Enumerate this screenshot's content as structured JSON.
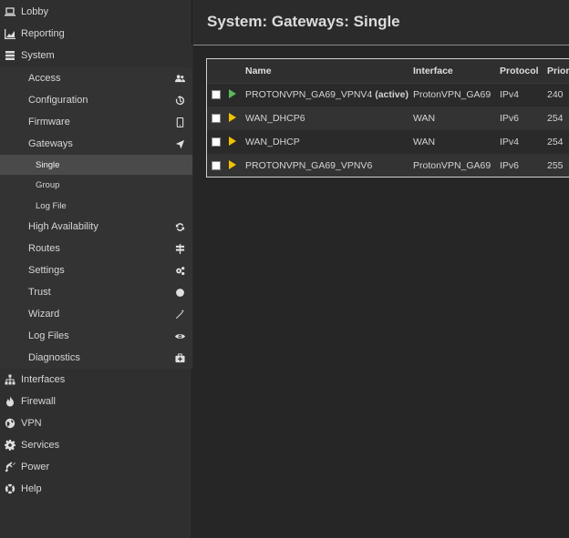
{
  "sidebar": {
    "top_items": [
      {
        "label": "Lobby",
        "icon": "laptop-icon"
      },
      {
        "label": "Reporting",
        "icon": "area-chart-icon"
      },
      {
        "label": "System",
        "icon": "server-icon"
      }
    ],
    "system_items": [
      {
        "label": "Access",
        "icon": "users-icon"
      },
      {
        "label": "Configuration",
        "icon": "history-icon"
      },
      {
        "label": "Firmware",
        "icon": "tablet-icon"
      },
      {
        "label": "Gateways",
        "icon": "location-arrow-icon"
      }
    ],
    "gateway_items": [
      {
        "label": "Single",
        "active": true
      },
      {
        "label": "Group",
        "active": false
      },
      {
        "label": "Log File",
        "active": false
      }
    ],
    "system_items_after": [
      {
        "label": "High Availability",
        "icon": "refresh-icon"
      },
      {
        "label": "Routes",
        "icon": "map-signs-icon"
      },
      {
        "label": "Settings",
        "icon": "cogs-icon"
      },
      {
        "label": "Trust",
        "icon": "certificate-icon"
      },
      {
        "label": "Wizard",
        "icon": "magic-icon"
      },
      {
        "label": "Log Files",
        "icon": "eye-icon"
      },
      {
        "label": "Diagnostics",
        "icon": "medkit-icon"
      }
    ],
    "bottom_items": [
      {
        "label": "Interfaces",
        "icon": "sitemap-icon"
      },
      {
        "label": "Firewall",
        "icon": "fire-icon"
      },
      {
        "label": "VPN",
        "icon": "globe-icon"
      },
      {
        "label": "Services",
        "icon": "cog-icon"
      },
      {
        "label": "Power",
        "icon": "plug-icon"
      },
      {
        "label": "Help",
        "icon": "support-icon"
      }
    ]
  },
  "page": {
    "title": "System: Gateways: Single"
  },
  "table": {
    "columns": [
      "Name",
      "Interface",
      "Protocol",
      "Prior"
    ],
    "rows": [
      {
        "name": "PROTONVPN_GA69_VPNV4",
        "tag": "(active)",
        "interface": "ProtonVPN_GA69",
        "protocol": "IPv4",
        "priority": "240",
        "status": "green"
      },
      {
        "name": "WAN_DHCP6",
        "tag": "",
        "interface": "WAN",
        "protocol": "IPv6",
        "priority": "254",
        "status": "yellow"
      },
      {
        "name": "WAN_DHCP",
        "tag": "",
        "interface": "WAN",
        "protocol": "IPv4",
        "priority": "254",
        "status": "yellow"
      },
      {
        "name": "PROTONVPN_GA69_VPNV6",
        "tag": "",
        "interface": "ProtonVPN_GA69",
        "protocol": "IPv6",
        "priority": "255",
        "status": "yellow"
      }
    ]
  },
  "colors": {
    "status_active": "#5cb85c",
    "status_inactive": "#f2c200"
  }
}
